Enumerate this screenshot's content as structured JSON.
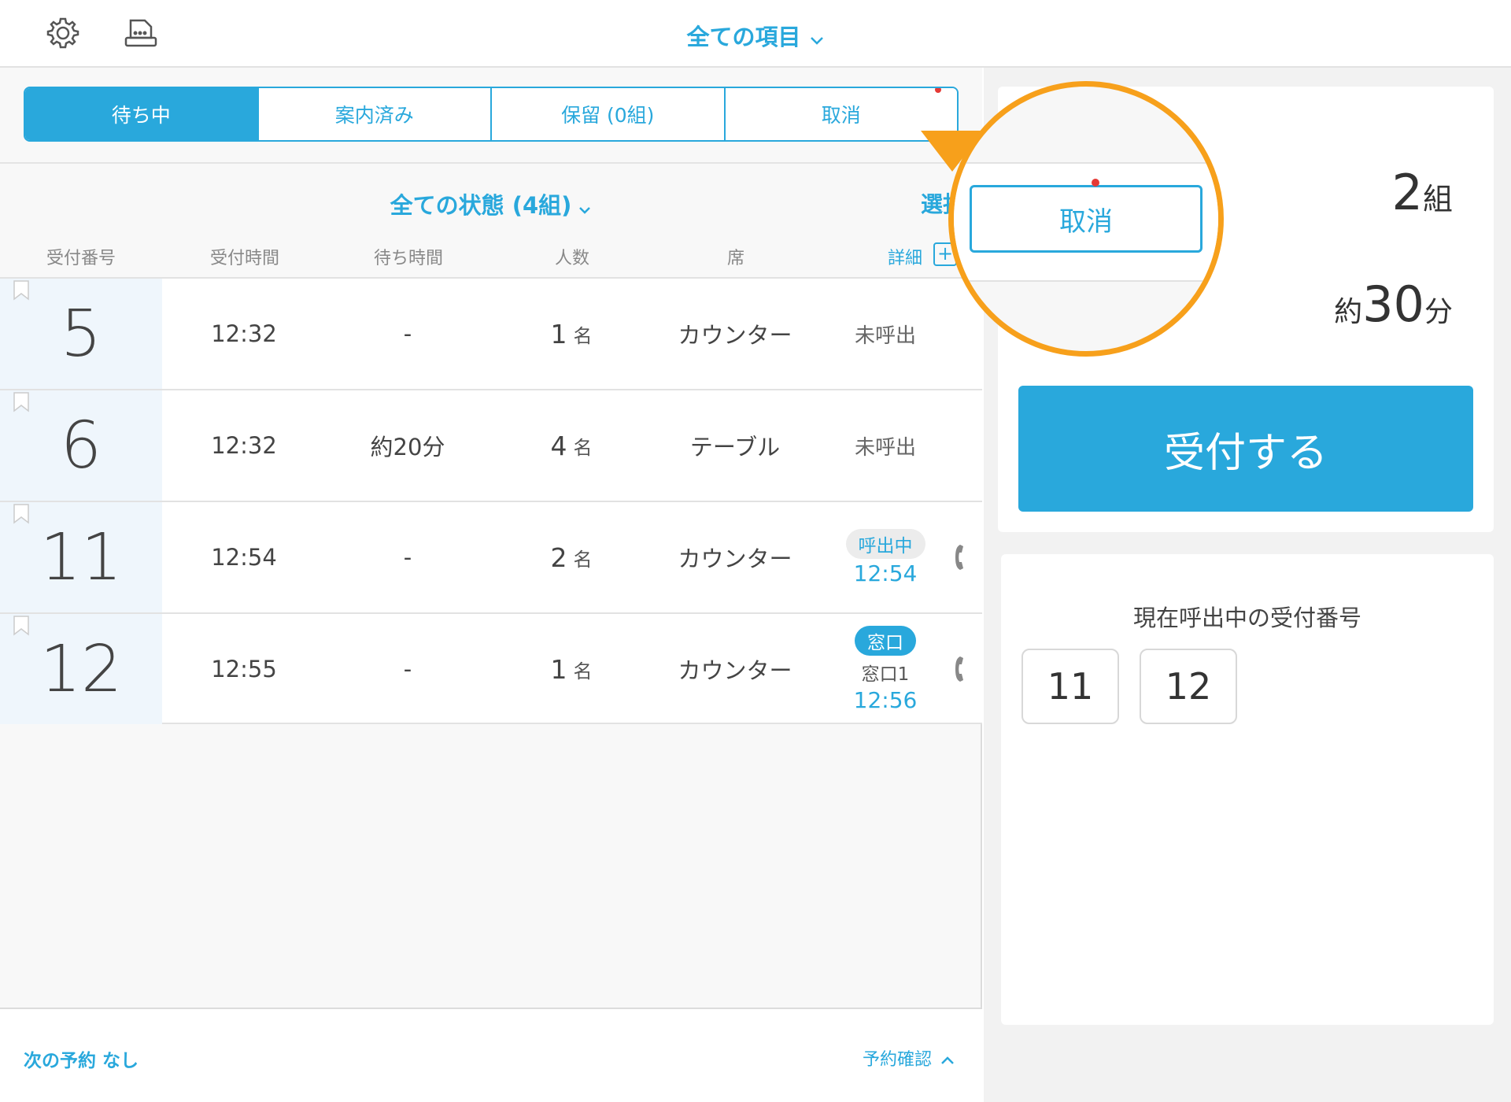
{
  "header": {
    "filter_title": "全ての項目"
  },
  "tabs": [
    {
      "label": "待ち中",
      "active": true
    },
    {
      "label": "案内済み",
      "active": false
    },
    {
      "label": "保留 (0組)",
      "active": false
    },
    {
      "label": "取消",
      "active": false
    }
  ],
  "list": {
    "state_filter": "全ての状態 (4組)",
    "select_label": "選択",
    "columns": {
      "number": "受付番号",
      "time": "受付時間",
      "wait": "待ち時間",
      "people": "人数",
      "seat": "席",
      "detail": "詳細"
    },
    "rows": [
      {
        "number": "5",
        "time": "12:32",
        "wait": "-",
        "people": "1",
        "people_unit": "名",
        "seat": "カウンター",
        "status": "未呼出"
      },
      {
        "number": "6",
        "time": "12:32",
        "wait": "約20分",
        "people": "4",
        "people_unit": "名",
        "seat": "テーブル",
        "status": "未呼出"
      },
      {
        "number": "11",
        "time": "12:54",
        "wait": "-",
        "people": "2",
        "people_unit": "名",
        "seat": "カウンター",
        "status_pill": "呼出中",
        "status_time": "12:54"
      },
      {
        "number": "12",
        "time": "12:55",
        "wait": "-",
        "people": "1",
        "people_unit": "名",
        "seat": "カウンター",
        "status_pill": "窓口",
        "status_sub": "窓口1",
        "status_time": "12:56"
      }
    ]
  },
  "footer": {
    "next_reservation": "次の予約 なし",
    "reservation_confirm": "予約確認"
  },
  "summary": {
    "groups_value": "2",
    "groups_unit": "組",
    "wait_prefix": "約",
    "wait_value": "30",
    "wait_unit": "分",
    "accept_button": "受付する"
  },
  "calling": {
    "title": "現在呼出中の受付番号",
    "numbers": [
      "11",
      "12"
    ]
  },
  "callout": {
    "button_label": "取消"
  },
  "colors": {
    "accent": "#29a8dc",
    "highlight": "#f7a01b",
    "notification": "#e53935"
  }
}
